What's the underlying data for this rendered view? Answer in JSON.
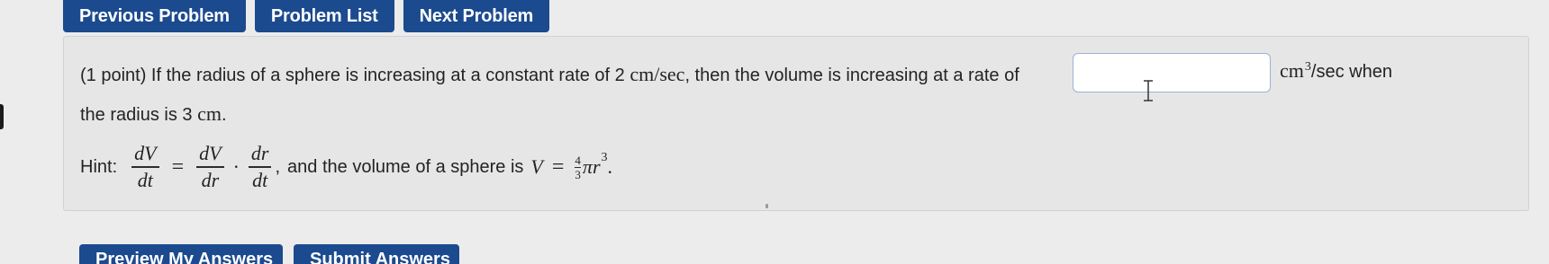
{
  "nav": {
    "previous": "Previous Problem",
    "list": "Problem List",
    "next": "Next Problem"
  },
  "problem": {
    "text_a": "(1 point) If the radius of a sphere is increasing at a constant rate of 2 ",
    "rate_unit": "cm/sec",
    "text_b": ", then the volume is increasing at a rate of",
    "answer_value": "",
    "result_unit": "cm",
    "result_power": "3",
    "result_suffix": "/sec when",
    "text_c": "the radius is 3 ",
    "radius_unit": "cm",
    "text_d": "."
  },
  "hint": {
    "label": "Hint:",
    "lhs_num": "dV",
    "lhs_den": "dt",
    "equals": "=",
    "mid_num": "dV",
    "mid_den": "dr",
    "dot": "·",
    "rhs_num": "dr",
    "rhs_den": "dt",
    "comma": ",",
    "sentence": "and the volume of a sphere is",
    "v_symbol": "V",
    "v_equals": "=",
    "coef_num": "4",
    "coef_den": "3",
    "pi": "π",
    "r_symbol": "r",
    "r_power": "3",
    "period": "."
  },
  "actions": {
    "preview": "Preview My Answers",
    "submit": "Submit Answers"
  },
  "colors": {
    "button_bg": "#1b4a8f",
    "button_text": "#ffffff",
    "page_bg": "#ececec",
    "box_bg": "#e6e6e6",
    "input_border": "#9bb3d4"
  },
  "icons": {
    "cursor": "text-cursor-icon"
  }
}
